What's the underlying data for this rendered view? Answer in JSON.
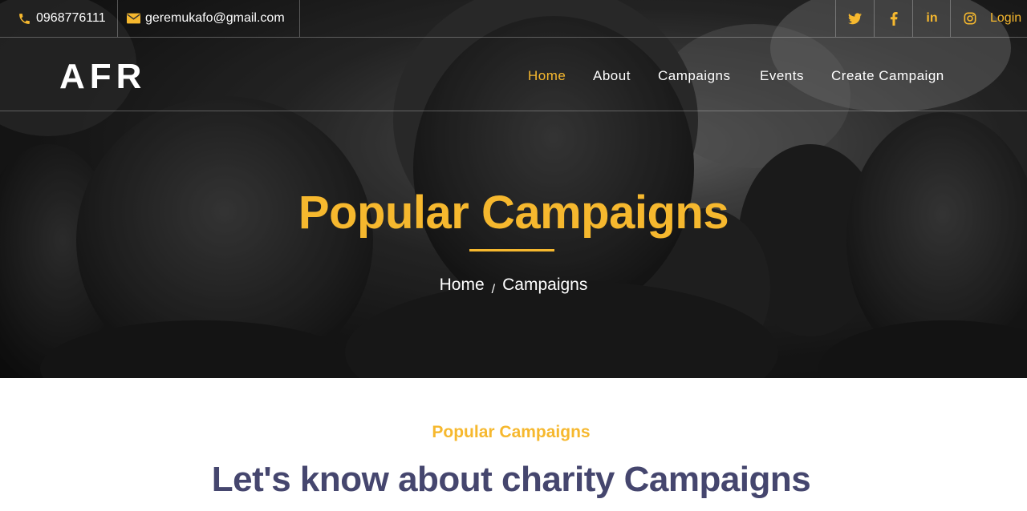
{
  "topbar": {
    "phone": "0968776111",
    "email": "geremukafo@gmail.com",
    "phone_icon": "phone-icon",
    "email_icon": "envelope-icon",
    "social": [
      "twitter-icon",
      "facebook-icon",
      "linkedin-icon",
      "instagram-icon"
    ],
    "login": "Login"
  },
  "navbar": {
    "logo": "AFR",
    "items": [
      "Home",
      "About",
      "Campaigns",
      "Events",
      "Create Campaign"
    ],
    "active": "Home"
  },
  "hero": {
    "title": "Popular Campaigns",
    "breadcrumb": {
      "home": "Home",
      "separator": "/",
      "current": "Campaigns"
    }
  },
  "section": {
    "label": "Popular Campaigns",
    "heading": "Let's know about charity Campaigns"
  },
  "colors": {
    "accent": "#f6b82e",
    "heading": "#45466e",
    "white": "#ffffff"
  }
}
